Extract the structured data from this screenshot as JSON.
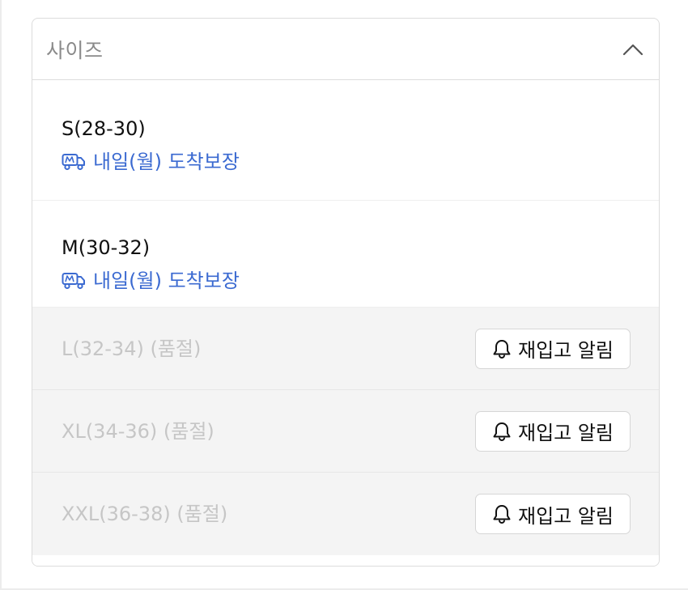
{
  "dropdown": {
    "label": "사이즈",
    "expanded_icon": "chevron-up-icon"
  },
  "options": [
    {
      "name": "S(28-30)",
      "status": "available",
      "delivery": "내일(월) 도착보장",
      "icon": "truck-icon"
    },
    {
      "name": "M(30-32)",
      "status": "available",
      "delivery": "내일(월) 도착보장",
      "icon": "truck-icon"
    },
    {
      "name": "L(32-34) (품절)",
      "status": "soldout",
      "button": "재입고 알림",
      "icon": "bell-icon"
    },
    {
      "name": "XL(34-36) (품절)",
      "status": "soldout",
      "button": "재입고 알림",
      "icon": "bell-icon"
    },
    {
      "name": "XXL(36-38) (품절)",
      "status": "soldout",
      "button": "재입고 알림",
      "icon": "bell-icon"
    }
  ],
  "colors": {
    "delivery_blue": "#3b6ad1",
    "soldout_bg": "#f4f4f4",
    "soldout_text": "#c6c6c6"
  }
}
